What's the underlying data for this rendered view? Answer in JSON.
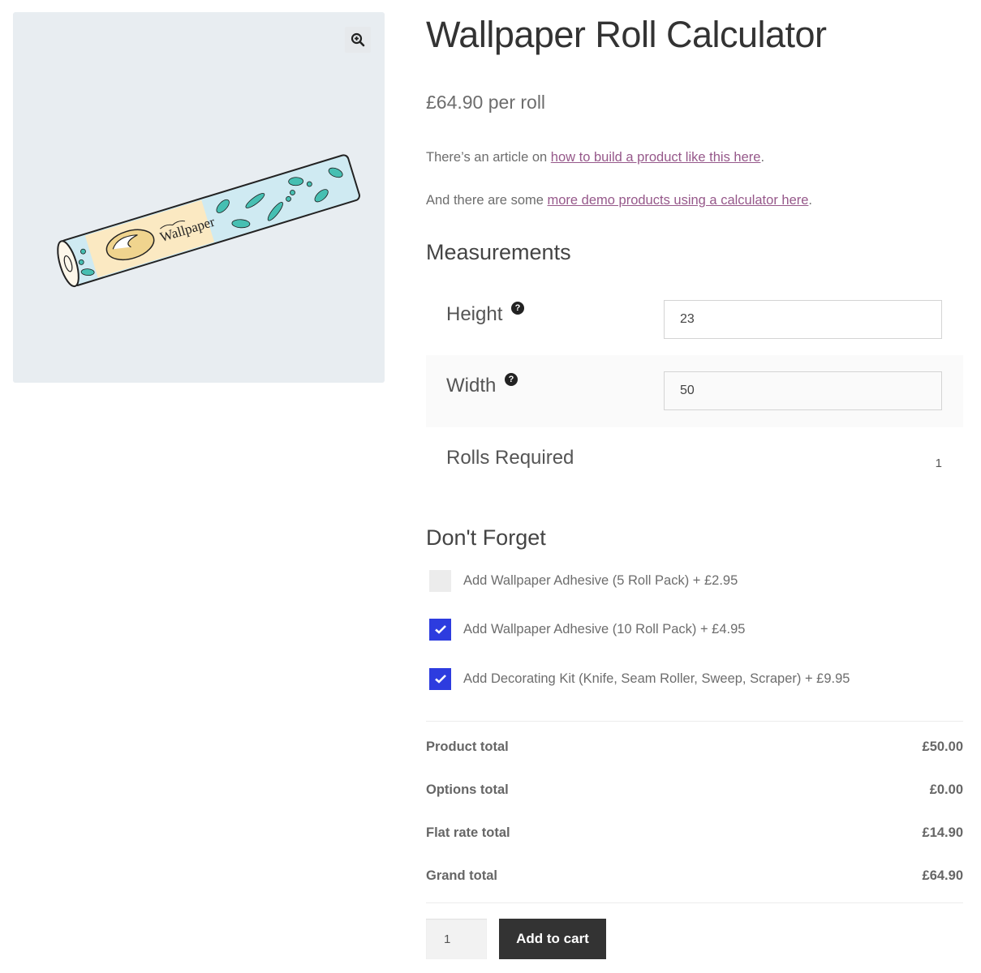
{
  "gallery": {
    "zoom_icon": "magnifier-plus-icon",
    "image_label": "Wallpaper",
    "image_description": "Illustrated wallpaper roll with leaf pattern"
  },
  "product": {
    "title": "Wallpaper Roll Calculator",
    "price": "£64.90 per roll",
    "intro1_prefix": "There’s an article on ",
    "intro1_link": "how to build a product like this here",
    "intro1_suffix": ".",
    "intro2_prefix": "And there are some ",
    "intro2_link": "more demo products using a calculator here",
    "intro2_suffix": "."
  },
  "measurements": {
    "heading": "Measurements",
    "height": {
      "label": "Height",
      "value": "23",
      "help_icon": "question-circle-icon",
      "help_glyph": "?"
    },
    "width": {
      "label": "Width",
      "value": "50",
      "help_icon": "question-circle-icon",
      "help_glyph": "?"
    },
    "rolls": {
      "label": "Rolls Required",
      "value": "1"
    }
  },
  "addons": {
    "heading": "Don't Forget",
    "items": [
      {
        "label": "Add Wallpaper Adhesive (5 Roll Pack) + £2.95",
        "checked": false
      },
      {
        "label": "Add Wallpaper Adhesive (10 Roll Pack) + £4.95",
        "checked": true
      },
      {
        "label": "Add Decorating Kit (Knife, Seam Roller, Sweep, Scraper) + £9.95",
        "checked": true
      }
    ]
  },
  "totals": [
    {
      "label": "Product total",
      "value": "£50.00"
    },
    {
      "label": "Options total",
      "value": "£0.00"
    },
    {
      "label": "Flat rate total",
      "value": "£14.90"
    },
    {
      "label": "Grand total",
      "value": "£64.90"
    }
  ],
  "cart": {
    "quantity": "1",
    "button_label": "Add to cart"
  },
  "colors": {
    "link": "#96588a",
    "checkbox_checked": "#2d3cdf",
    "button_bg": "#333333",
    "gallery_bg": "#e8edf1"
  }
}
